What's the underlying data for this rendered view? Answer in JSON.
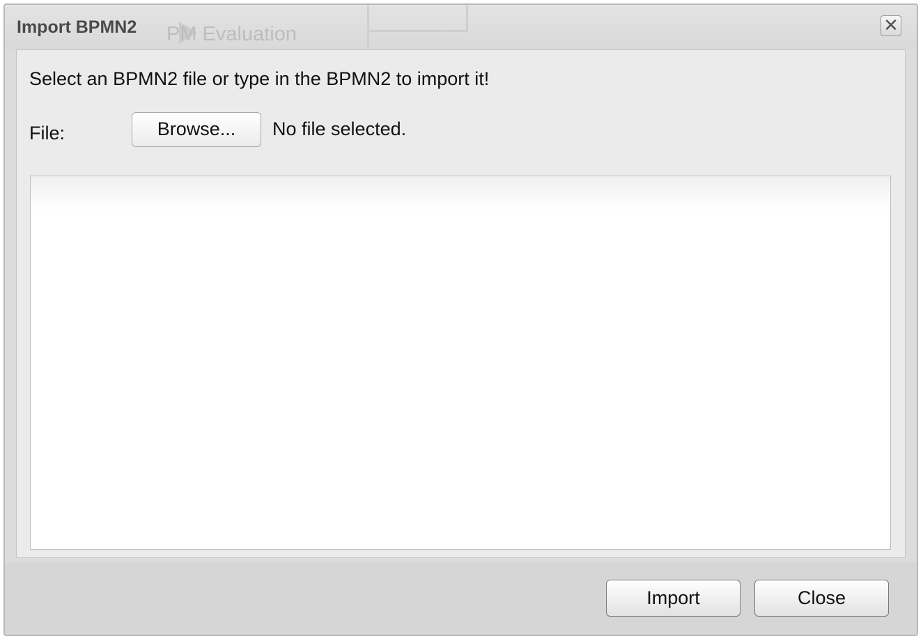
{
  "dialog": {
    "title": "Import BPMN2",
    "close_icon_glyph": "✕",
    "background_ghost_text": "PM Evaluation"
  },
  "content": {
    "instructions": "Select an BPMN2 file or type in the BPMN2 to import it!",
    "file_label": "File:",
    "browse_label": "Browse...",
    "file_status": "No file selected.",
    "bpmn_text_value": "",
    "bpmn_text_placeholder": ""
  },
  "footer": {
    "import_label": "Import",
    "close_label": "Close"
  },
  "colors": {
    "dialog_bg": "#dcdcdc",
    "panel_bg": "#ebebeb",
    "title_text": "#4a4a4a"
  }
}
